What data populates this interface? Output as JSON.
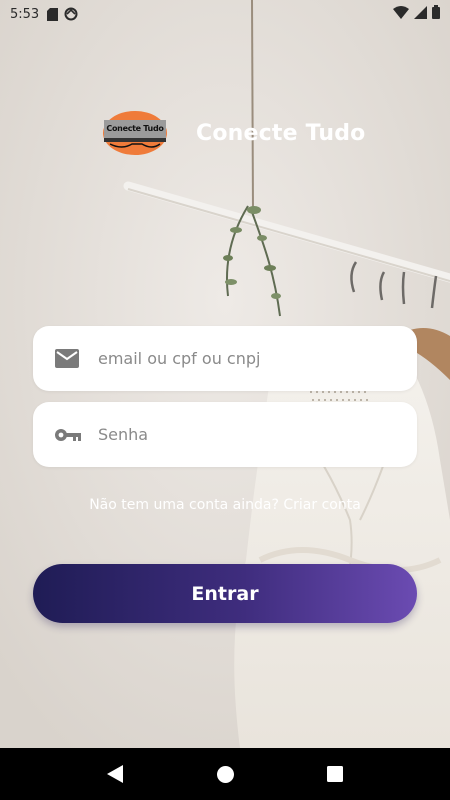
{
  "status_bar": {
    "time": "5:53",
    "icons": [
      "sd-card-icon",
      "sync-icon",
      "wifi-icon",
      "signal-icon",
      "battery-icon"
    ]
  },
  "header": {
    "logo_text": "Conecte Tudo",
    "app_title": "Conecte Tudo"
  },
  "form": {
    "email_placeholder": "email ou cpf ou cnpj",
    "email_value": "",
    "password_placeholder": "Senha",
    "password_value": "",
    "signup_prompt": "Não tem uma conta ainda?",
    "signup_link": "Criar conta",
    "submit_label": "Entrar"
  },
  "theme": {
    "button_gradient_start": "#1f1c55",
    "button_gradient_end": "#6b4bb2",
    "logo_orange": "#ef7b3a",
    "field_bg": "#ffffff"
  },
  "nav_bar": {
    "buttons": [
      "back-icon",
      "home-icon",
      "recents-icon"
    ]
  }
}
